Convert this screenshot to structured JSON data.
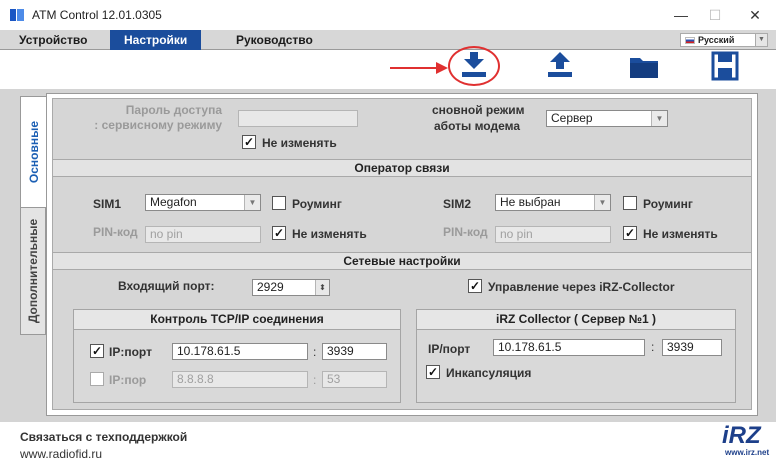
{
  "window": {
    "title": "ATM Control 12.01.0305",
    "controls": {
      "minimize": "—",
      "maximize": "☐",
      "close": "✕"
    }
  },
  "menu": {
    "items": [
      "Устройство",
      "Настройки",
      "Руководство"
    ],
    "active": "Настройки",
    "language": "Русский"
  },
  "toolbar": {
    "icons": [
      "download-icon",
      "upload-icon",
      "folder-icon",
      "save-icon"
    ],
    "highlighted": "download-icon",
    "accent": "#1b4d9c",
    "highlight_color": "#e03030"
  },
  "side_tabs": [
    "Основные",
    "Дополнительные"
  ],
  "access": {
    "password_label_1": "Пароль доступа",
    "password_label_2": ": сервисному режиму",
    "password_value": "",
    "no_change_label": "Не изменять",
    "no_change_checked": true,
    "main_mode_label_1": "сновной режим",
    "main_mode_label_2": "аботы модема",
    "main_mode_value": "Сервер"
  },
  "operator": {
    "header": "Оператор связи",
    "sim1": {
      "label": "SIM1",
      "value": "Megafon",
      "roaming_label": "Роуминг",
      "roaming_checked": false,
      "pin_label": "PIN-код",
      "pin_placeholder": "no pin",
      "no_change_label": "Не изменять",
      "no_change_checked": true
    },
    "sim2": {
      "label": "SIM2",
      "value": "Не выбран",
      "roaming_label": "Роуминг",
      "roaming_checked": false,
      "pin_label": "PIN-код",
      "pin_placeholder": "no pin",
      "no_change_label": "Не изменять",
      "no_change_checked": true
    }
  },
  "network": {
    "header": "Сетевые настройки",
    "incoming_port_label": "Входящий порт:",
    "incoming_port_value": "2929",
    "collector_label": "Управление через iRZ-Collector",
    "collector_checked": true
  },
  "tcp": {
    "header": "Контроль TCP/IP соединения",
    "row1_label": "IP:порт",
    "row1_checked": true,
    "row1_ip": "10.178.61.5",
    "row1_port": "3939",
    "row2_label": "IP:пор",
    "row2_checked": false,
    "row2_ip": "8.8.8.8",
    "row2_port": "53",
    "sep": ":"
  },
  "irz": {
    "header": "iRZ Collector ( Сервер №1 )",
    "ip_label": "IP/порт",
    "ip": "10.178.61.5",
    "port": "3939",
    "sep": ":",
    "encaps_label": "Инкапсуляция",
    "encaps_checked": true
  },
  "footer": {
    "support": "Связаться с техподдержкой",
    "url": "www.radiofid.ru",
    "logo_text": "iRZ",
    "logo_url": "www.irz.net"
  }
}
